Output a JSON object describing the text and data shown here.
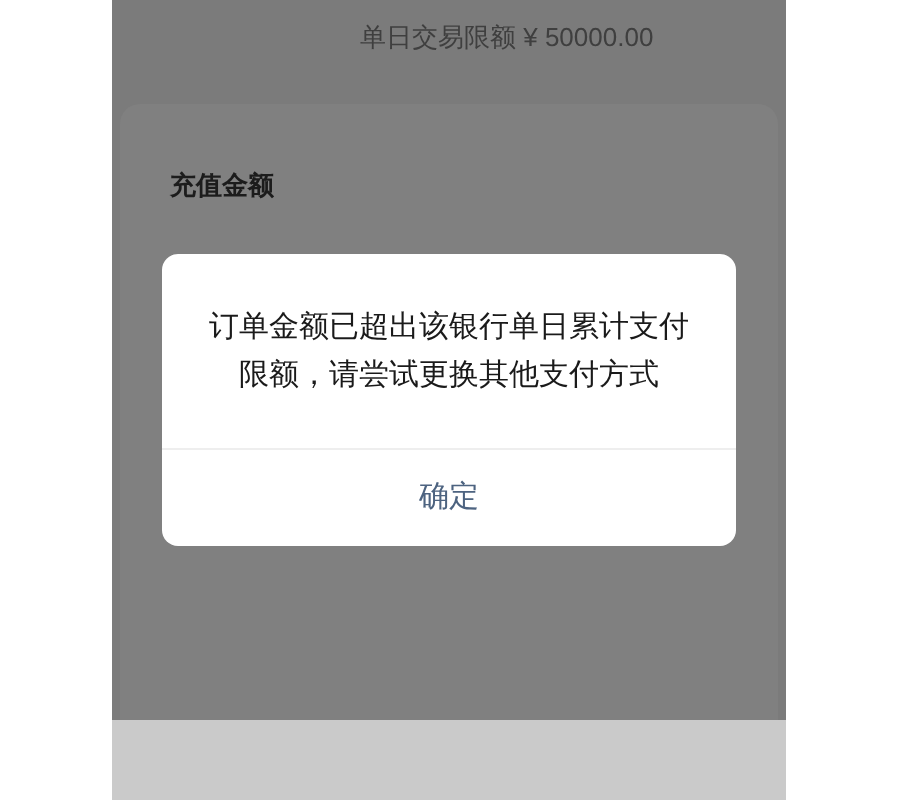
{
  "limit_text": "单日交易限额 ¥ 50000.00",
  "recharge_label": "充值金额",
  "dialog": {
    "message": "订单金额已超出该银行单日累计支付限额，请尝试更换其他支付方式",
    "button": "确定"
  }
}
